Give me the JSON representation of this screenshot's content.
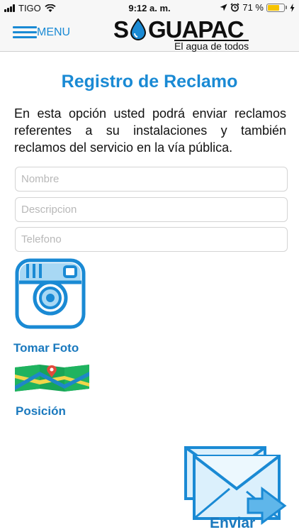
{
  "status": {
    "carrier": "TIGO",
    "time": "9:12 a. m.",
    "battery": "71 %",
    "battery_level": 0.71
  },
  "nav": {
    "menu_label": "MENU",
    "logo_left": "S",
    "logo_right": "GUAPAC",
    "logo_tagline": "El agua de todos"
  },
  "page": {
    "title": "Registro de Reclamo",
    "intro": "En esta opción usted podrá enviar reclamos referentes a su instalaciones y también reclamos del servicio en la vía pública."
  },
  "form": {
    "name_placeholder": "Nombre",
    "description_placeholder": "Descripcion",
    "phone_placeholder": "Telefono"
  },
  "actions": {
    "photo_label": "Tomar Foto",
    "position_label": "Posición",
    "send_label": "Enviar"
  },
  "colors": {
    "accent": "#1a8ad4",
    "battery": "#f6c300"
  }
}
